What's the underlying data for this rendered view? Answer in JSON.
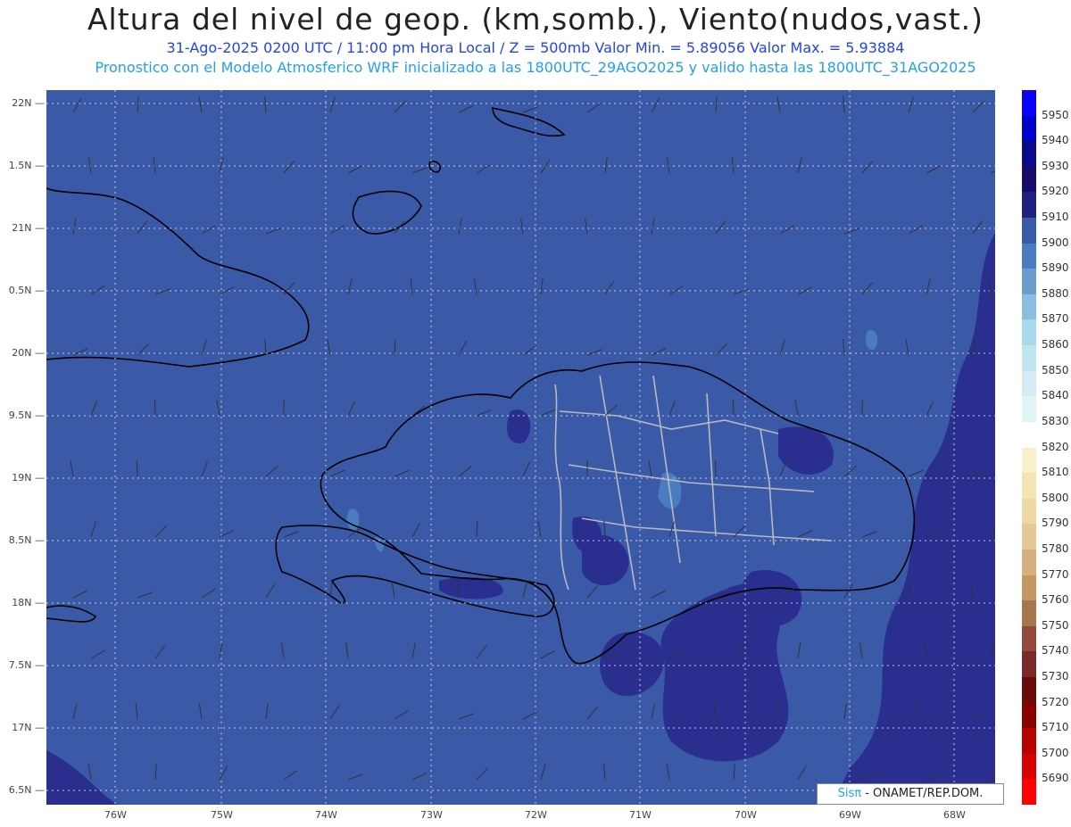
{
  "header": {
    "title": "Altura del nivel de geop. (km,somb.), Viento(nudos,vast.)",
    "line1": "31-Ago-2025  0200 UTC / 11:00 pm Hora Local / Z = 500mb    Valor Min. = 5.89056  Valor Max. = 5.93884",
    "line2": "Pronostico con el Modelo Atmosferico WRF inicializado a las 1800UTC_29AGO2025 y valido hasta las  1800UTC_31AGO2025"
  },
  "map": {
    "lat_labels": [
      "22N",
      "1.5N",
      "21N",
      "0.5N",
      "20N",
      "9.5N",
      "19N",
      "8.5N",
      "18N",
      "7.5N",
      "17N",
      "6.5N"
    ],
    "lon_labels": [
      "76W",
      "75W",
      "74W",
      "73W",
      "72W",
      "71W",
      "70W",
      "69W",
      "68W"
    ],
    "colors": {
      "background_field": "#3a5aa8",
      "high_field": "#2a2e8e",
      "light_field": "#4a7cc0",
      "coastline": "#000000",
      "province_lines": "#b8b8c0",
      "barbs": "#333333"
    }
  },
  "colorbar": {
    "labels": [
      "5950",
      "5940",
      "5930",
      "5920",
      "5910",
      "5900",
      "5890",
      "5880",
      "5870",
      "5860",
      "5850",
      "5840",
      "5830",
      "5820",
      "5810",
      "5800",
      "5790",
      "5780",
      "5770",
      "5760",
      "5750",
      "5740",
      "5730",
      "5720",
      "5710",
      "5700",
      "5690"
    ],
    "colors": [
      "#0a00ff",
      "#0000cc",
      "#0a0a8a",
      "#1a0a6a",
      "#202080",
      "#3a5aa8",
      "#4a7cc0",
      "#6a9ccc",
      "#8abde0",
      "#a8d8ec",
      "#c0e4f0",
      "#d4ecf6",
      "#e0f4f8",
      "#ffffff",
      "#f8f0c8",
      "#f4e4b4",
      "#eed8a4",
      "#e6c894",
      "#d8b080",
      "#c49664",
      "#a8764e",
      "#944a3a",
      "#7a2a2a",
      "#6a0a0a",
      "#8a0000",
      "#b80000",
      "#d80000",
      "#ff0000"
    ]
  },
  "credit": {
    "brand": "Sisπ",
    "org": " - ONAMET/REP.DOM."
  }
}
